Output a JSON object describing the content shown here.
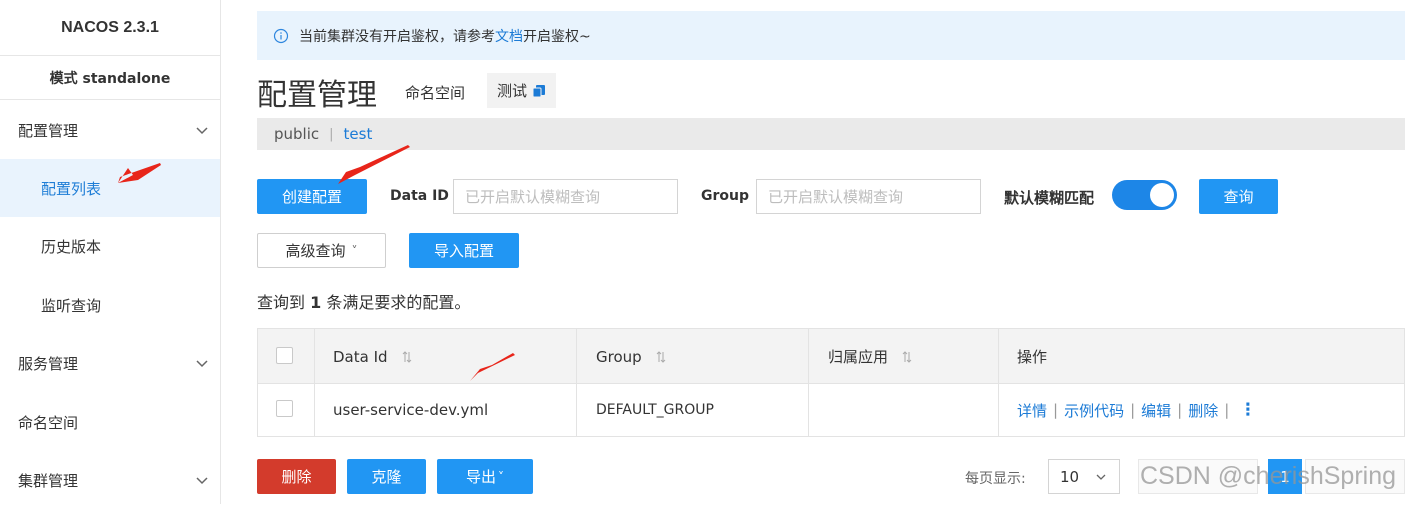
{
  "brand": {
    "title": "NACOS 2.3.1",
    "mode": "模式 standalone"
  },
  "sidebar": {
    "items": [
      {
        "label": "配置管理",
        "expandable": true
      },
      {
        "label": "配置列表",
        "active": true
      },
      {
        "label": "历史版本"
      },
      {
        "label": "监听查询"
      },
      {
        "label": "服务管理",
        "expandable": true
      },
      {
        "label": "命名空间"
      },
      {
        "label": "集群管理",
        "expandable": true
      }
    ]
  },
  "notice": {
    "prefix": "当前集群没有开启鉴权，请参考",
    "link": "文档",
    "suffix": "开启鉴权~",
    "icon": "info-icon"
  },
  "header": {
    "title": "配置管理",
    "namespace_label": "命名空间",
    "namespace_value": "测试",
    "copy_icon": "copy-icon"
  },
  "namespaces": {
    "items": [
      "public",
      "test"
    ],
    "separator": "|",
    "active": "test"
  },
  "toolbar": {
    "create_label": "创建配置",
    "data_id_label": "Data ID",
    "data_id_placeholder": "已开启默认模糊查询",
    "group_label": "Group",
    "group_placeholder": "已开启默认模糊查询",
    "fuzzy_label": "默认模糊匹配",
    "fuzzy_on": true,
    "query_label": "查询",
    "advanced_label": "高级查询",
    "advanced_chevron": "˅",
    "import_label": "导入配置"
  },
  "result": {
    "prefix": "查询到",
    "count": "1",
    "suffix": "条满足要求的配置。"
  },
  "table": {
    "columns": [
      "Data Id",
      "Group",
      "归属应用",
      "操作"
    ],
    "rows": [
      {
        "data_id": "user-service-dev.yml",
        "group": "DEFAULT_GROUP",
        "app": "",
        "ops": [
          "详情",
          "示例代码",
          "编辑",
          "删除"
        ]
      }
    ],
    "op_separator": "|",
    "more": "⋮"
  },
  "footer": {
    "delete_label": "删除",
    "clone_label": "克隆",
    "export_label": "导出",
    "export_chevron": "˅",
    "page_size_label": "每页显示:",
    "page_size": "10",
    "current_page": "1"
  },
  "watermark": "CSDN @cherishSpring",
  "colors": {
    "accent": "#2196f3",
    "danger": "#d33b2c",
    "link": "#1c7bd6",
    "annotation": "#e8251a"
  }
}
